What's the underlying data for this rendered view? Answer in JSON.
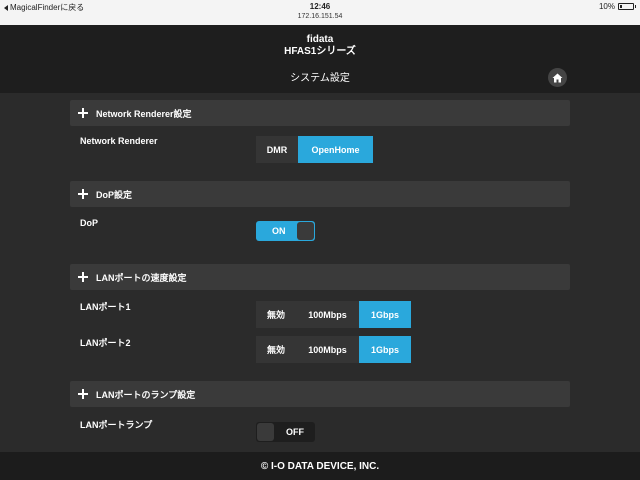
{
  "statusbar": {
    "back_label": "MagicalFinderに戻る",
    "time": "12:46",
    "url": "172.16.151.54",
    "battery": "10%",
    "battery_level": 0.1
  },
  "header": {
    "brand": "fidata",
    "series": "HFAS1シリーズ",
    "page_title": "システム設定",
    "home_icon": "home-icon"
  },
  "sections": {
    "network_renderer": {
      "title": "Network Renderer設定",
      "row_label": "Network Renderer",
      "options": [
        "DMR",
        "OpenHome"
      ],
      "selected": "OpenHome"
    },
    "dop": {
      "title": "DoP設定",
      "row_label": "DoP",
      "toggle_label": "ON",
      "state": "on"
    },
    "lan_speed": {
      "title": "LANポートの速度設定",
      "port1_label": "LANポート1",
      "port2_label": "LANポート2",
      "options": [
        "無効",
        "100Mbps",
        "1Gbps"
      ],
      "port1_selected": "1Gbps",
      "port2_selected": "1Gbps"
    },
    "lan_lamp": {
      "title": "LANポートのランプ設定",
      "row_label": "LANポートランプ",
      "toggle_label": "OFF",
      "state": "off"
    }
  },
  "footer": {
    "copyright": "© I-O DATA DEVICE, INC."
  },
  "colors": {
    "accent": "#2aa8dc",
    "background": "#2b2b2b",
    "header": "#1e1e1e"
  }
}
